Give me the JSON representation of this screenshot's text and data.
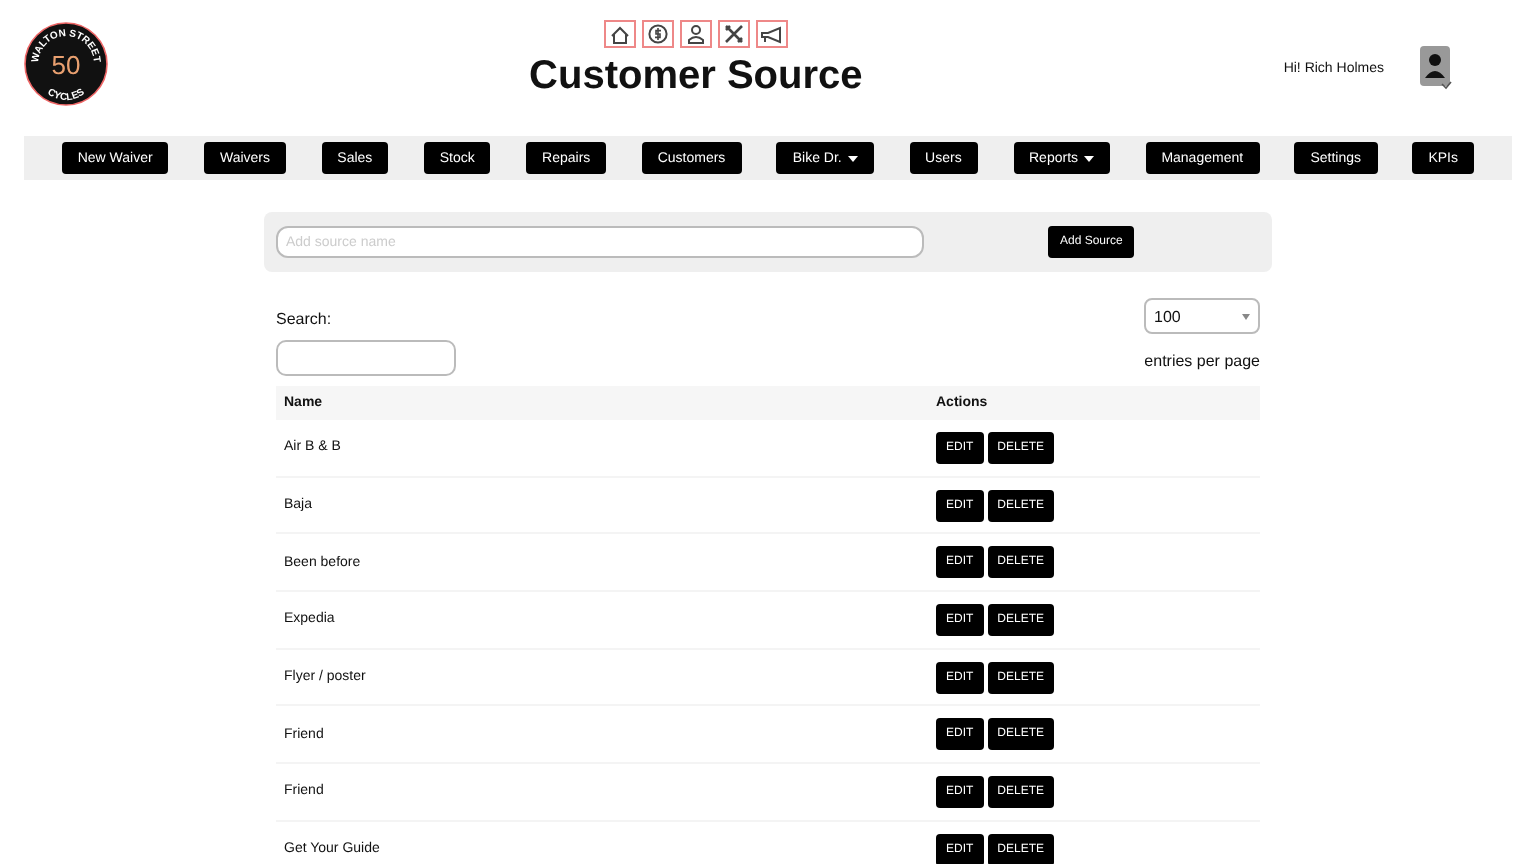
{
  "logo": {
    "top_text": "WALTON STREET",
    "number": "50",
    "bottom_text": "CYCLES"
  },
  "page_title": "Customer Source",
  "greeting": "Hi! Rich Holmes",
  "nav": [
    {
      "label": "New Waiver",
      "dropdown": false
    },
    {
      "label": "Waivers",
      "dropdown": false
    },
    {
      "label": "Sales",
      "dropdown": false
    },
    {
      "label": "Stock",
      "dropdown": false
    },
    {
      "label": "Repairs",
      "dropdown": false
    },
    {
      "label": "Customers",
      "dropdown": false
    },
    {
      "label": "Bike Dr.",
      "dropdown": true
    },
    {
      "label": "Users",
      "dropdown": false
    },
    {
      "label": "Reports",
      "dropdown": true
    },
    {
      "label": "Management",
      "dropdown": false
    },
    {
      "label": "Settings",
      "dropdown": false
    },
    {
      "label": "KPIs",
      "dropdown": false
    }
  ],
  "add_form": {
    "placeholder": "Add source name",
    "button": "Add Source"
  },
  "search": {
    "label": "Search:"
  },
  "page_size": {
    "value": "100",
    "label": "entries per page"
  },
  "table": {
    "columns": [
      "Name",
      "Actions"
    ],
    "rows": [
      {
        "name": "Air B & B",
        "edit": "EDIT",
        "delete": "DELETE"
      },
      {
        "name": "Baja",
        "edit": "EDIT",
        "delete": "DELETE"
      },
      {
        "name": "Been before",
        "edit": "EDIT",
        "delete": "DELETE"
      },
      {
        "name": "Expedia",
        "edit": "EDIT",
        "delete": "DELETE"
      },
      {
        "name": "Flyer / poster",
        "edit": "EDIT",
        "delete": "DELETE"
      },
      {
        "name": "Friend",
        "edit": "EDIT",
        "delete": "DELETE"
      },
      {
        "name": "Friend",
        "edit": "EDIT",
        "delete": "DELETE"
      },
      {
        "name": "Get Your Guide",
        "edit": "EDIT",
        "delete": "DELETE"
      }
    ]
  }
}
